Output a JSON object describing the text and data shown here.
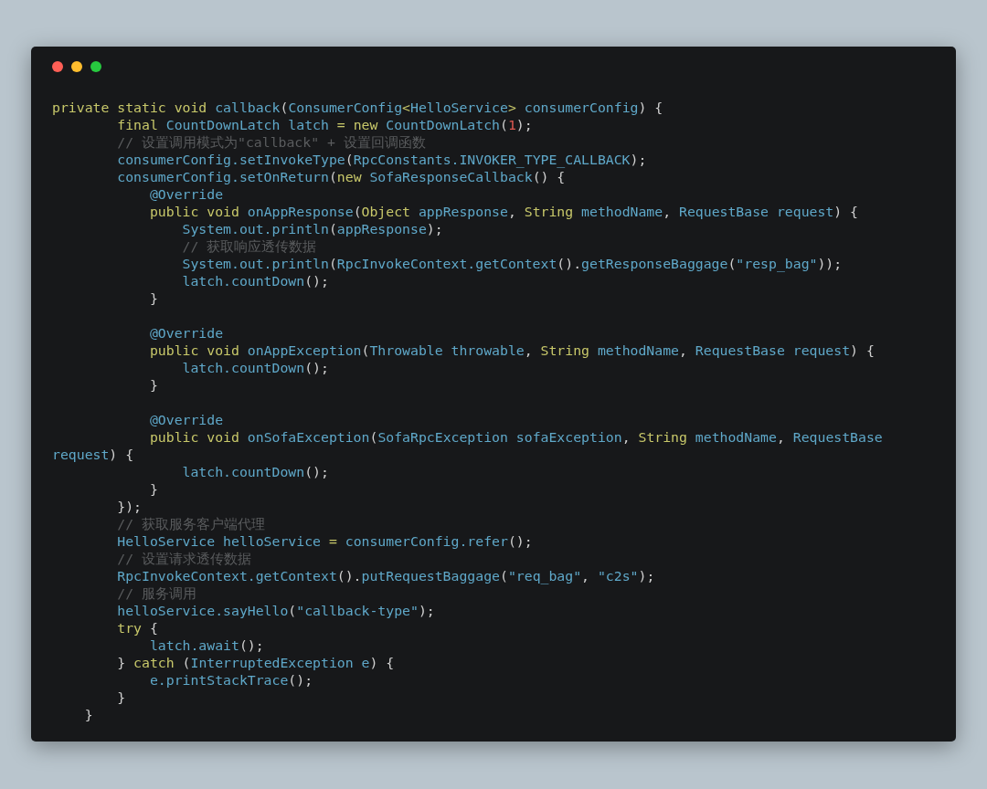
{
  "editor": {
    "lines": [
      {
        "kind": "code",
        "tokens": [
          {
            "kind": "kw",
            "text": "private static void "
          },
          {
            "kind": "id",
            "text": "callback"
          },
          {
            "kind": "p",
            "text": "("
          },
          {
            "kind": "id",
            "text": "ConsumerConfig"
          },
          {
            "kind": "op",
            "text": "<"
          },
          {
            "kind": "id",
            "text": "HelloService"
          },
          {
            "kind": "op",
            "text": ">"
          },
          {
            "kind": "id",
            "text": " consumerConfig"
          },
          {
            "kind": "p",
            "text": ") {"
          }
        ]
      },
      {
        "kind": "code",
        "tokens": [
          {
            "kind": "kw",
            "text": "        final "
          },
          {
            "kind": "id",
            "text": "CountDownLatch latch "
          },
          {
            "kind": "op",
            "text": "= "
          },
          {
            "kind": "kw",
            "text": "new "
          },
          {
            "kind": "id",
            "text": "CountDownLatch"
          },
          {
            "kind": "p",
            "text": "("
          },
          {
            "kind": "num",
            "text": "1"
          },
          {
            "kind": "p",
            "text": ");"
          }
        ]
      },
      {
        "kind": "code",
        "tokens": [
          {
            "kind": "cm",
            "text": "        // 设置调用模式为\"callback\" + 设置回调函数"
          }
        ]
      },
      {
        "kind": "code",
        "tokens": [
          {
            "kind": "id",
            "text": "        consumerConfig.setInvokeType"
          },
          {
            "kind": "p",
            "text": "("
          },
          {
            "kind": "id",
            "text": "RpcConstants.INVOKER_TYPE_CALLBACK"
          },
          {
            "kind": "p",
            "text": ");"
          }
        ]
      },
      {
        "kind": "code",
        "tokens": [
          {
            "kind": "id",
            "text": "        consumerConfig.setOnReturn"
          },
          {
            "kind": "p",
            "text": "("
          },
          {
            "kind": "kw",
            "text": "new "
          },
          {
            "kind": "id",
            "text": "SofaResponseCallback"
          },
          {
            "kind": "p",
            "text": "() {"
          }
        ]
      },
      {
        "kind": "code",
        "tokens": [
          {
            "kind": "id",
            "text": "            @Override"
          }
        ]
      },
      {
        "kind": "code",
        "tokens": [
          {
            "kind": "kw",
            "text": "            public void "
          },
          {
            "kind": "id",
            "text": "onAppResponse"
          },
          {
            "kind": "p",
            "text": "("
          },
          {
            "kind": "kw",
            "text": "Object "
          },
          {
            "kind": "id",
            "text": "appResponse"
          },
          {
            "kind": "p",
            "text": ", "
          },
          {
            "kind": "kw",
            "text": "String "
          },
          {
            "kind": "id",
            "text": "methodName"
          },
          {
            "kind": "p",
            "text": ", "
          },
          {
            "kind": "id",
            "text": "RequestBase request"
          },
          {
            "kind": "p",
            "text": ") {"
          }
        ]
      },
      {
        "kind": "code",
        "tokens": [
          {
            "kind": "id",
            "text": "                System.out.println"
          },
          {
            "kind": "p",
            "text": "("
          },
          {
            "kind": "id",
            "text": "appResponse"
          },
          {
            "kind": "p",
            "text": ");"
          }
        ]
      },
      {
        "kind": "code",
        "tokens": [
          {
            "kind": "cm",
            "text": "                // 获取响应透传数据"
          }
        ]
      },
      {
        "kind": "code",
        "tokens": [
          {
            "kind": "id",
            "text": "                System.out.println"
          },
          {
            "kind": "p",
            "text": "("
          },
          {
            "kind": "id",
            "text": "RpcInvokeContext.getContext"
          },
          {
            "kind": "p",
            "text": "()."
          },
          {
            "kind": "id",
            "text": "getResponseBaggage"
          },
          {
            "kind": "p",
            "text": "("
          },
          {
            "kind": "id",
            "text": "\"resp_bag\""
          },
          {
            "kind": "p",
            "text": "));"
          }
        ]
      },
      {
        "kind": "code",
        "tokens": [
          {
            "kind": "id",
            "text": "                latch.countDown"
          },
          {
            "kind": "p",
            "text": "();"
          }
        ]
      },
      {
        "kind": "code",
        "tokens": [
          {
            "kind": "p",
            "text": "            }"
          }
        ]
      },
      {
        "kind": "blank"
      },
      {
        "kind": "code",
        "tokens": [
          {
            "kind": "id",
            "text": "            @Override"
          }
        ]
      },
      {
        "kind": "code",
        "tokens": [
          {
            "kind": "kw",
            "text": "            public void "
          },
          {
            "kind": "id",
            "text": "onAppException"
          },
          {
            "kind": "p",
            "text": "("
          },
          {
            "kind": "id",
            "text": "Throwable throwable"
          },
          {
            "kind": "p",
            "text": ", "
          },
          {
            "kind": "kw",
            "text": "String "
          },
          {
            "kind": "id",
            "text": "methodName"
          },
          {
            "kind": "p",
            "text": ", "
          },
          {
            "kind": "id",
            "text": "RequestBase request"
          },
          {
            "kind": "p",
            "text": ") {"
          }
        ]
      },
      {
        "kind": "code",
        "tokens": [
          {
            "kind": "id",
            "text": "                latch.countDown"
          },
          {
            "kind": "p",
            "text": "();"
          }
        ]
      },
      {
        "kind": "code",
        "tokens": [
          {
            "kind": "p",
            "text": "            }"
          }
        ]
      },
      {
        "kind": "blank"
      },
      {
        "kind": "code",
        "tokens": [
          {
            "kind": "id",
            "text": "            @Override"
          }
        ]
      },
      {
        "kind": "code",
        "tokens": [
          {
            "kind": "kw",
            "text": "            public void "
          },
          {
            "kind": "id",
            "text": "onSofaException"
          },
          {
            "kind": "p",
            "text": "("
          },
          {
            "kind": "id",
            "text": "SofaRpcException sofaException"
          },
          {
            "kind": "p",
            "text": ", "
          },
          {
            "kind": "kw",
            "text": "String "
          },
          {
            "kind": "id",
            "text": "methodName"
          },
          {
            "kind": "p",
            "text": ", "
          },
          {
            "kind": "id",
            "text": "RequestBase"
          }
        ]
      },
      {
        "kind": "code",
        "tokens": [
          {
            "kind": "id",
            "text": "request"
          },
          {
            "kind": "p",
            "text": ") {"
          }
        ]
      },
      {
        "kind": "code",
        "tokens": [
          {
            "kind": "id",
            "text": "                latch.countDown"
          },
          {
            "kind": "p",
            "text": "();"
          }
        ]
      },
      {
        "kind": "code",
        "tokens": [
          {
            "kind": "p",
            "text": "            }"
          }
        ]
      },
      {
        "kind": "code",
        "tokens": [
          {
            "kind": "p",
            "text": "        });"
          }
        ]
      },
      {
        "kind": "code",
        "tokens": [
          {
            "kind": "cm",
            "text": "        // 获取服务客户端代理"
          }
        ]
      },
      {
        "kind": "code",
        "tokens": [
          {
            "kind": "id",
            "text": "        HelloService helloService "
          },
          {
            "kind": "op",
            "text": "= "
          },
          {
            "kind": "id",
            "text": "consumerConfig.refer"
          },
          {
            "kind": "p",
            "text": "();"
          }
        ]
      },
      {
        "kind": "code",
        "tokens": [
          {
            "kind": "cm",
            "text": "        // 设置请求透传数据"
          }
        ]
      },
      {
        "kind": "code",
        "tokens": [
          {
            "kind": "id",
            "text": "        RpcInvokeContext.getContext"
          },
          {
            "kind": "p",
            "text": "()."
          },
          {
            "kind": "id",
            "text": "putRequestBaggage"
          },
          {
            "kind": "p",
            "text": "("
          },
          {
            "kind": "id",
            "text": "\"req_bag\""
          },
          {
            "kind": "p",
            "text": ", "
          },
          {
            "kind": "id",
            "text": "\"c2s\""
          },
          {
            "kind": "p",
            "text": ");"
          }
        ]
      },
      {
        "kind": "code",
        "tokens": [
          {
            "kind": "cm",
            "text": "        // 服务调用"
          }
        ]
      },
      {
        "kind": "code",
        "tokens": [
          {
            "kind": "id",
            "text": "        helloService.sayHello"
          },
          {
            "kind": "p",
            "text": "("
          },
          {
            "kind": "id",
            "text": "\"callback-type\""
          },
          {
            "kind": "p",
            "text": ");"
          }
        ]
      },
      {
        "kind": "code",
        "tokens": [
          {
            "kind": "kw",
            "text": "        try "
          },
          {
            "kind": "p",
            "text": "{"
          }
        ]
      },
      {
        "kind": "code",
        "tokens": [
          {
            "kind": "id",
            "text": "            latch.await"
          },
          {
            "kind": "p",
            "text": "();"
          }
        ]
      },
      {
        "kind": "code",
        "tokens": [
          {
            "kind": "p",
            "text": "        } "
          },
          {
            "kind": "kw",
            "text": "catch "
          },
          {
            "kind": "p",
            "text": "("
          },
          {
            "kind": "id",
            "text": "InterruptedException e"
          },
          {
            "kind": "p",
            "text": ") {"
          }
        ]
      },
      {
        "kind": "code",
        "tokens": [
          {
            "kind": "id",
            "text": "            e.printStackTrace"
          },
          {
            "kind": "p",
            "text": "();"
          }
        ]
      },
      {
        "kind": "code",
        "tokens": [
          {
            "kind": "p",
            "text": "        }"
          }
        ]
      },
      {
        "kind": "code",
        "tokens": [
          {
            "kind": "p",
            "text": "    }"
          }
        ]
      }
    ]
  }
}
